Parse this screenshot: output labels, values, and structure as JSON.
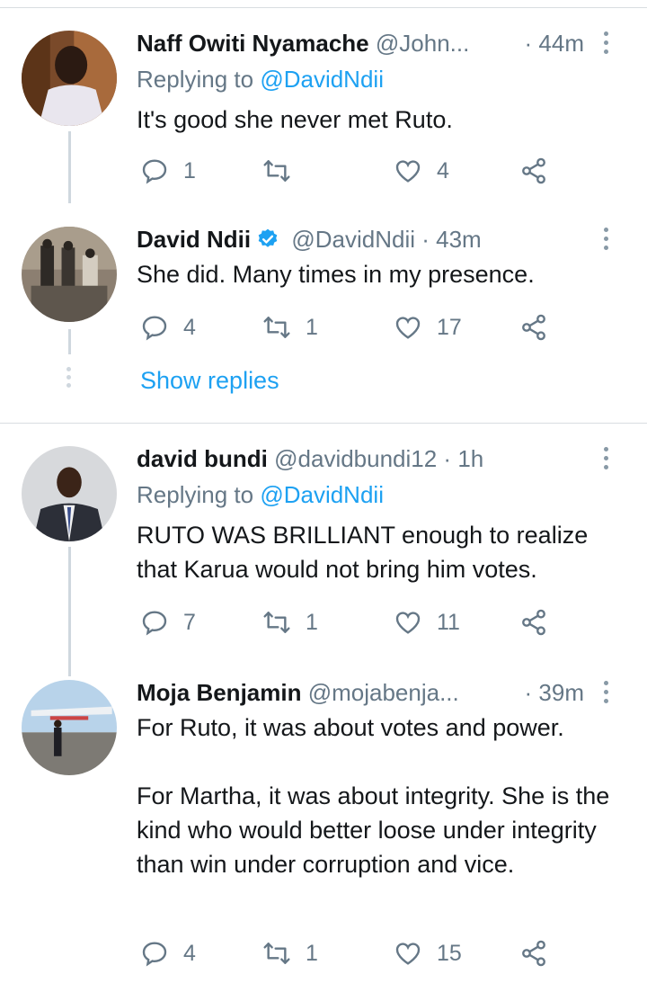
{
  "tweets": [
    {
      "name": "Naff Owiti Nyamache",
      "handle": "@John...",
      "time": "· 44m",
      "replying_label": "Replying to",
      "replying_to": "@DavidNdii",
      "text": "It's good she never met Ruto.",
      "replies": "1",
      "retweets": "",
      "likes": "4"
    },
    {
      "name": "David Ndii",
      "verified": true,
      "handle": "@DavidNdii · 43m",
      "text": "She did. Many times in my presence.",
      "replies": "4",
      "retweets": "1",
      "likes": "17",
      "show_replies": "Show replies"
    },
    {
      "name": "david bundi",
      "handle": "@davidbundi12 · 1h",
      "replying_label": "Replying to",
      "replying_to": "@DavidNdii",
      "text": "RUTO WAS BRILLIANT enough to realize that Karua would not bring him votes.",
      "replies": "7",
      "retweets": "1",
      "likes": "11"
    },
    {
      "name": "Moja Benjamin",
      "handle": "@mojabenja...",
      "time": "· 39m",
      "text": "For Ruto, it was about votes and power.\n\nFor Martha, it was about integrity. She is the kind who would better loose under integrity than win under corruption and vice.",
      "replies": "4",
      "retweets": "1",
      "likes": "15"
    }
  ],
  "icons": {
    "reply": "reply-icon",
    "retweet": "retweet-icon",
    "like": "heart-icon",
    "share": "share-icon",
    "verified": "verified-badge-icon",
    "more": "more-options-icon"
  },
  "colors": {
    "link": "#1da1f2",
    "muted": "#657786",
    "divider": "#d9dde1",
    "verified": "#1da1f2"
  }
}
